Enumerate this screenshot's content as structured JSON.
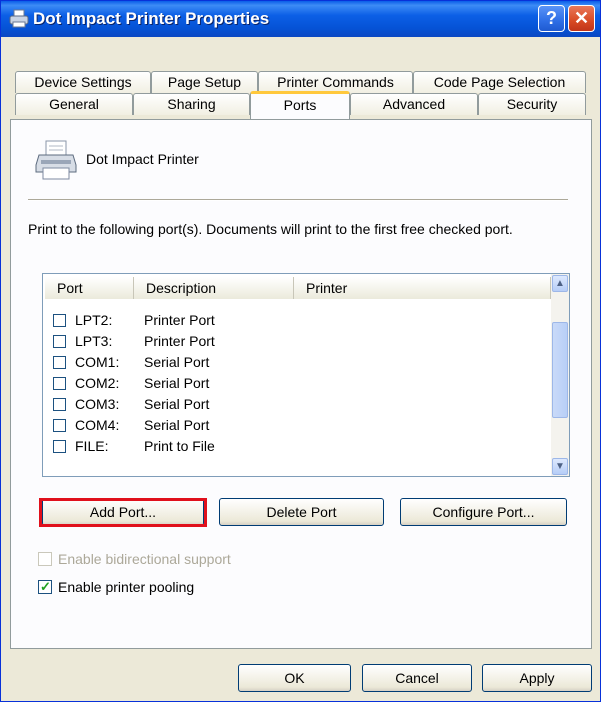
{
  "window": {
    "title": "Dot Impact Printer Properties",
    "help_glyph": "?",
    "close_glyph": "✕",
    "accent": "#0a5ee8"
  },
  "tabs_row1": [
    "Device Settings",
    "Page Setup",
    "Printer Commands",
    "Code Page Selection"
  ],
  "tabs_row2": [
    "General",
    "Sharing",
    "Ports",
    "Advanced",
    "Security"
  ],
  "active_tab": "Ports",
  "printer": {
    "icon": "printer-icon",
    "name": "Dot Impact Printer"
  },
  "description": "Print to the following port(s). Documents will print to the first free checked port.",
  "port_list": {
    "columns": [
      "Port",
      "Description",
      "Printer"
    ],
    "rows": [
      {
        "port": "LPT2:",
        "description": "Printer Port",
        "checked": false
      },
      {
        "port": "LPT3:",
        "description": "Printer Port",
        "checked": false
      },
      {
        "port": "COM1:",
        "description": "Serial Port",
        "checked": false
      },
      {
        "port": "COM2:",
        "description": "Serial Port",
        "checked": false
      },
      {
        "port": "COM3:",
        "description": "Serial Port",
        "checked": false
      },
      {
        "port": "COM4:",
        "description": "Serial Port",
        "checked": false
      },
      {
        "port": "FILE:",
        "description": "Print to File",
        "checked": false
      }
    ]
  },
  "port_buttons": {
    "add": "Add Port...",
    "delete": "Delete Port",
    "configure": "Configure Port..."
  },
  "options": {
    "bidirectional": {
      "label": "Enable bidirectional support",
      "checked": false,
      "enabled": false
    },
    "pooling": {
      "label": "Enable printer pooling",
      "checked": true,
      "enabled": true
    }
  },
  "dialog_buttons": {
    "ok": "OK",
    "cancel": "Cancel",
    "apply": "Apply"
  },
  "highlight_color": "#e0101c"
}
